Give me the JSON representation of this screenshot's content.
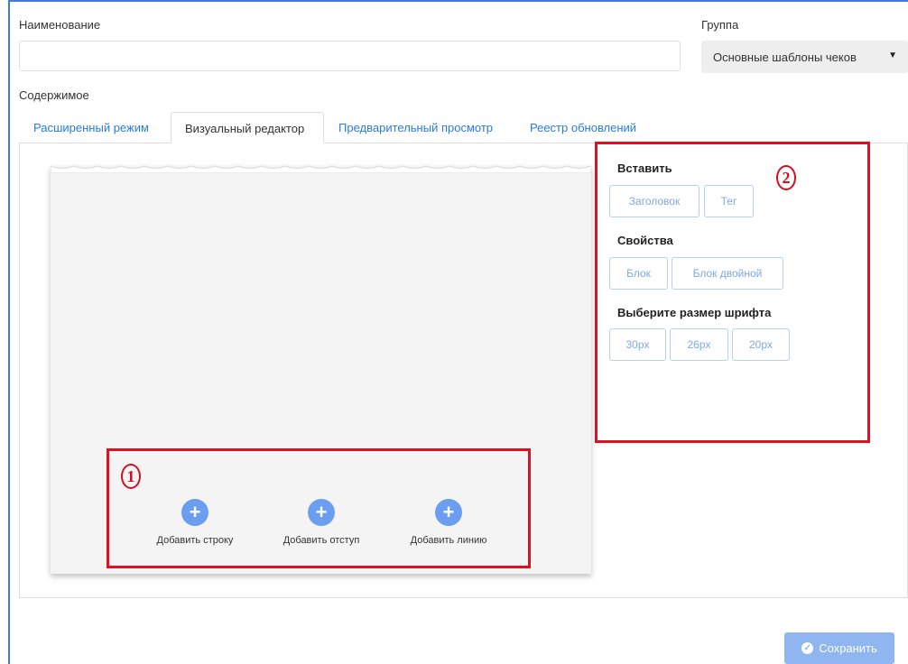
{
  "form": {
    "name_label": "Наименование",
    "name_value": "",
    "group_label": "Группа",
    "group_value": "Основные шаблоны чеков",
    "content_label": "Содержимое"
  },
  "tabs": [
    {
      "label": "Расширенный режим",
      "active": false
    },
    {
      "label": "Визуальный редактор",
      "active": true
    },
    {
      "label": "Предварительный просмотр",
      "active": false
    },
    {
      "label": "Реестр обновлений",
      "active": false
    }
  ],
  "editor": {
    "add_buttons": [
      {
        "icon": "plus-icon",
        "label": "Добавить строку"
      },
      {
        "icon": "plus-icon",
        "label": "Добавить отступ"
      },
      {
        "icon": "plus-icon",
        "label": "Добавить линию"
      }
    ]
  },
  "panel": {
    "insert_title": "Вставить",
    "insert_buttons": [
      "Заголовок",
      "Тег"
    ],
    "props_title": "Свойства",
    "props_buttons": [
      "Блок",
      "Блок двойной"
    ],
    "font_title": "Выберите размер шрифта",
    "font_buttons": [
      "30px",
      "26px",
      "20px"
    ]
  },
  "annotations": {
    "marker1": "1",
    "marker2": "2",
    "color": "#e01020"
  },
  "footer": {
    "save_label": "Сохранить",
    "save_icon": "check-circle-icon"
  },
  "colors": {
    "accent": "#2a7ae2",
    "plus_button": "#6b9ef0",
    "save_button": "#8fb6f0"
  }
}
